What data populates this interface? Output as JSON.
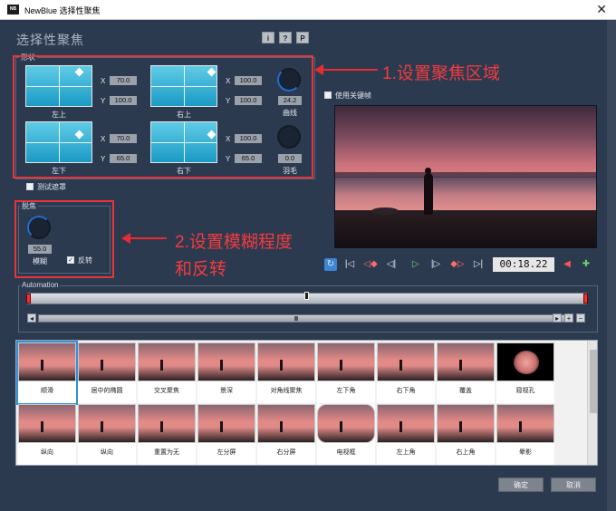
{
  "window": {
    "title": "NewBlue 选择性聚焦",
    "app_icon": "NB",
    "close_symbol": "✕"
  },
  "heading": "选择性聚焦",
  "top_buttons": [
    "i",
    "?",
    "P"
  ],
  "shape_group": {
    "label": "形状",
    "corners": [
      {
        "label": "左上",
        "x": "70.0",
        "y": "100.0"
      },
      {
        "label": "右上",
        "x": "100.0",
        "y": "100.0"
      },
      {
        "label": "左下",
        "x": "70.0",
        "y": "65.0"
      },
      {
        "label": "右下",
        "x": "100.0",
        "y": "65.0"
      }
    ],
    "curve": {
      "label": "曲线",
      "value": "24.2"
    },
    "feather": {
      "label": "羽毛",
      "value": "0.0"
    },
    "test_mask_label": "测试遮罩",
    "x_label": "X",
    "y_label": "Y"
  },
  "blur_group": {
    "label": "脱焦",
    "blur": {
      "label": "模糊",
      "value": "55.0"
    },
    "invert": {
      "label": "反转",
      "checked": true
    }
  },
  "use_keyframes_label": "使用关键帧",
  "annotations": {
    "first": "1.设置聚焦区域",
    "second_line1": "2.设置模糊程度",
    "second_line2": "和反转"
  },
  "transport": {
    "timecode": "00:18.22",
    "buttons": [
      "loop-icon",
      "go-start-icon",
      "prev-keyframe-icon",
      "step-back-icon",
      "play-icon",
      "step-forward-icon",
      "next-keyframe-icon",
      "go-end-icon",
      "remove-keyframe-icon",
      "add-keyframe-icon"
    ]
  },
  "automation": {
    "label": "Automation"
  },
  "gallery": {
    "row1": [
      "顺滑",
      "居中的椭圆",
      "交叉聚焦",
      "景深",
      "对角线聚焦",
      "左下角",
      "右下角",
      "覆盖",
      "窥视孔"
    ],
    "row2": [
      "纵向",
      "纵向",
      "重置为无",
      "左分屏",
      "右分屏",
      "电视框",
      "左上角",
      "右上角",
      "晕影"
    ]
  },
  "footer": {
    "ok_label": "确定",
    "cancel_label": "取消"
  },
  "colors": {
    "accent_red": "#e8343b",
    "panel": "#2c3a4f",
    "shape_blue": "#1c9ac4"
  }
}
